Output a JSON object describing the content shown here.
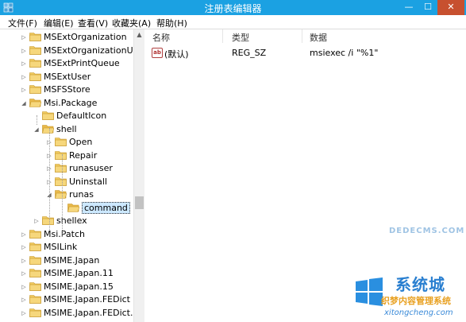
{
  "window": {
    "title": "注册表编辑器",
    "minimize_glyph": "—",
    "maximize_glyph": "☐",
    "close_glyph": "✕"
  },
  "menu": {
    "items": [
      "文件(F)",
      "编辑(E)",
      "查看(V)",
      "收藏夹(A)",
      "帮助(H)"
    ]
  },
  "tree": {
    "items": [
      {
        "label": "MSExtOrganization",
        "depth": 0,
        "expander": "▷",
        "state": "collapsed"
      },
      {
        "label": "MSExtOrganizationU",
        "depth": 0,
        "expander": "▷",
        "state": "collapsed"
      },
      {
        "label": "MSExtPrintQueue",
        "depth": 0,
        "expander": "▷",
        "state": "collapsed"
      },
      {
        "label": "MSExtUser",
        "depth": 0,
        "expander": "▷",
        "state": "collapsed"
      },
      {
        "label": "MSFSStore",
        "depth": 0,
        "expander": "▷",
        "state": "collapsed"
      },
      {
        "label": "Msi.Package",
        "depth": 0,
        "expander": "◢",
        "state": "expanded"
      },
      {
        "label": "DefaultIcon",
        "depth": 1,
        "expander": "",
        "state": "leaf"
      },
      {
        "label": "shell",
        "depth": 1,
        "expander": "◢",
        "state": "expanded"
      },
      {
        "label": "Open",
        "depth": 2,
        "expander": "▷",
        "state": "collapsed"
      },
      {
        "label": "Repair",
        "depth": 2,
        "expander": "▷",
        "state": "collapsed"
      },
      {
        "label": "runasuser",
        "depth": 2,
        "expander": "▷",
        "state": "collapsed"
      },
      {
        "label": "Uninstall",
        "depth": 2,
        "expander": "▷",
        "state": "collapsed"
      },
      {
        "label": "runas",
        "depth": 2,
        "expander": "◢",
        "state": "expanded"
      },
      {
        "label": "command",
        "depth": 3,
        "expander": "",
        "state": "selected"
      },
      {
        "label": "shellex",
        "depth": 1,
        "expander": "▷",
        "state": "collapsed"
      },
      {
        "label": "Msi.Patch",
        "depth": 0,
        "expander": "▷",
        "state": "collapsed"
      },
      {
        "label": "MSILink",
        "depth": 0,
        "expander": "▷",
        "state": "collapsed"
      },
      {
        "label": "MSIME.Japan",
        "depth": 0,
        "expander": "▷",
        "state": "collapsed"
      },
      {
        "label": "MSIME.Japan.11",
        "depth": 0,
        "expander": "▷",
        "state": "collapsed"
      },
      {
        "label": "MSIME.Japan.15",
        "depth": 0,
        "expander": "▷",
        "state": "collapsed"
      },
      {
        "label": "MSIME.Japan.FEDict",
        "depth": 0,
        "expander": "▷",
        "state": "collapsed"
      },
      {
        "label": "MSIME.Japan.FEDict.",
        "depth": 0,
        "expander": "▷",
        "state": "collapsed"
      }
    ],
    "scroll_up_glyph": "▲"
  },
  "list": {
    "columns": [
      "名称",
      "类型",
      "数据"
    ],
    "rows": [
      {
        "icon": "string-value-icon",
        "icon_text": "ab",
        "name": "(默认)",
        "type": "REG_SZ",
        "data": "msiexec /i \"%1\""
      }
    ]
  },
  "watermark": {
    "brand": "系统城",
    "domain": "DEDECMS.COM",
    "tagline": "织梦内容管理系统",
    "url": "xitongcheng.com"
  },
  "colors": {
    "titlebar": "#1ba1e2",
    "close_button": "#c7502f",
    "folder": "#e8c25a",
    "selection": "#cce8ff"
  }
}
